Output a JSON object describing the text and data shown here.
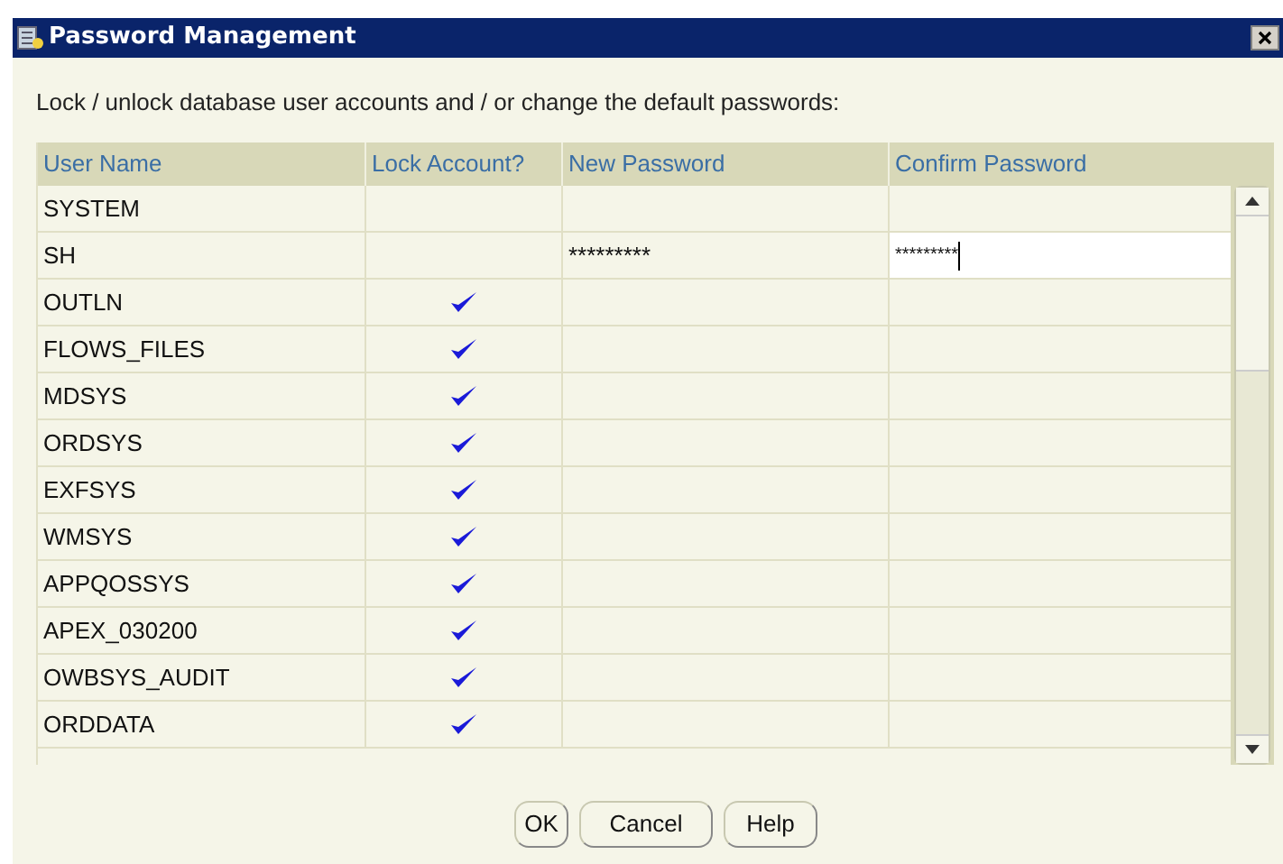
{
  "window": {
    "title": "Password Management"
  },
  "instruction": "Lock / unlock database user accounts and / or change the default passwords:",
  "table": {
    "columns": [
      "User Name",
      "Lock Account?",
      "New Password",
      "Confirm Password"
    ],
    "rows": [
      {
        "user": "SYSTEM",
        "locked": false,
        "new_password": "",
        "confirm_password": "",
        "editing": false
      },
      {
        "user": "SH",
        "locked": false,
        "new_password": "*********",
        "confirm_password": "*********",
        "editing": true
      },
      {
        "user": "OUTLN",
        "locked": true,
        "new_password": "",
        "confirm_password": "",
        "editing": false
      },
      {
        "user": "FLOWS_FILES",
        "locked": true,
        "new_password": "",
        "confirm_password": "",
        "editing": false
      },
      {
        "user": "MDSYS",
        "locked": true,
        "new_password": "",
        "confirm_password": "",
        "editing": false
      },
      {
        "user": "ORDSYS",
        "locked": true,
        "new_password": "",
        "confirm_password": "",
        "editing": false
      },
      {
        "user": "EXFSYS",
        "locked": true,
        "new_password": "",
        "confirm_password": "",
        "editing": false
      },
      {
        "user": "WMSYS",
        "locked": true,
        "new_password": "",
        "confirm_password": "",
        "editing": false
      },
      {
        "user": "APPQOSSYS",
        "locked": true,
        "new_password": "",
        "confirm_password": "",
        "editing": false
      },
      {
        "user": "APEX_030200",
        "locked": true,
        "new_password": "",
        "confirm_password": "",
        "editing": false
      },
      {
        "user": "OWBSYS_AUDIT",
        "locked": true,
        "new_password": "",
        "confirm_password": "",
        "editing": false
      },
      {
        "user": "ORDDATA",
        "locked": true,
        "new_password": "",
        "confirm_password": "",
        "editing": false
      }
    ]
  },
  "buttons": [
    "OK",
    "Cancel",
    "Help"
  ]
}
